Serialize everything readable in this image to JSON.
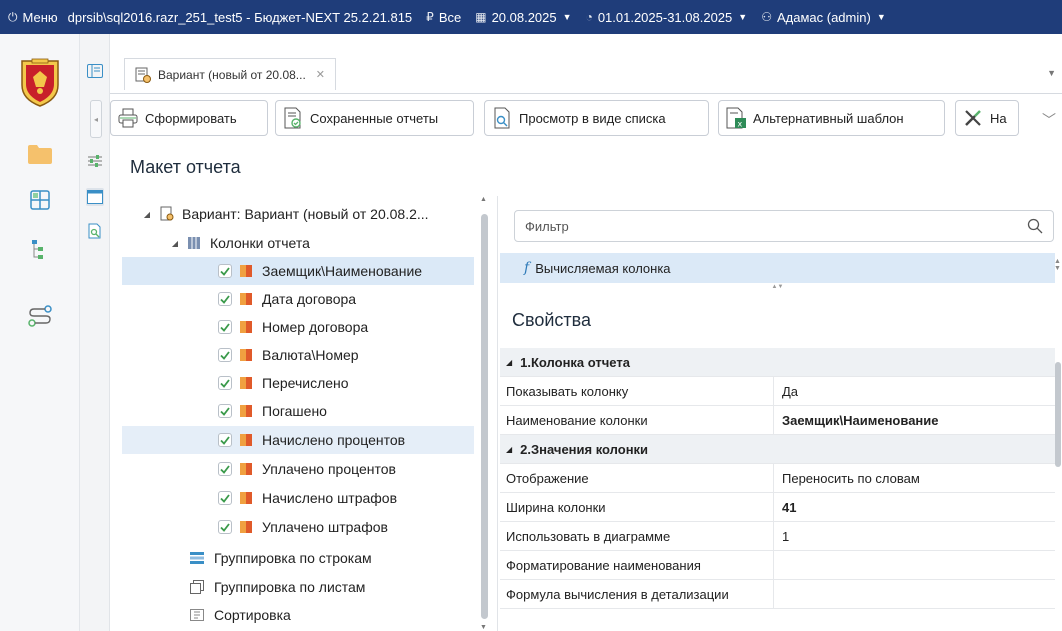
{
  "topbar": {
    "menu": "Меню",
    "connection": "dprsib\\sql2016.razr_251_test5 - Бюджет-NEXT 25.2.21.815",
    "scope": "Все",
    "date": "20.08.2025",
    "period": "01.01.2025-31.08.2025",
    "user": "Адамас (admin)"
  },
  "tab": {
    "title": "Вариант (новый от 20.08...",
    "close": "✕"
  },
  "toolbar": {
    "generate": "Сформировать",
    "saved_reports": "Сохраненные отчеты",
    "list_view": "Просмотр в виде списка",
    "alt_template": "Альтернативный шаблон",
    "more": "На"
  },
  "layout_title": "Макет отчета",
  "tree": {
    "root": "Вариант: Вариант (новый от 20.08.2...",
    "columns_node": "Колонки отчета",
    "columns": [
      "Заемщик\\Наименование",
      "Дата договора",
      "Номер договора",
      "Валюта\\Номер",
      "Перечислено",
      "Погашено",
      "Начислено процентов",
      "Уплачено процентов",
      "Начислено штрафов",
      "Уплачено штрафов"
    ],
    "row_grouping": "Группировка по строкам",
    "sheet_grouping": "Группировка по листам",
    "sorting": "Сортировка"
  },
  "filter_placeholder": "Фильтр",
  "calc_column": "Вычисляемая колонка",
  "properties": {
    "title": "Свойства",
    "cat1": "1.Колонка отчета",
    "show_col_k": "Показывать колонку",
    "show_col_v": "Да",
    "col_name_k": "Наименование колонки",
    "col_name_v": "Заемщик\\Наименование",
    "cat2": "2.Значения колонки",
    "display_k": "Отображение",
    "display_v": "Переносить по словам",
    "width_k": "Ширина колонки",
    "width_v": "41",
    "diagram_k": "Использовать в диаграмме",
    "diagram_v": "1",
    "fmt_k": "Форматирование наименования",
    "fmt_v": "",
    "formula_k": "Формула вычисления в детализации",
    "formula_v": ""
  },
  "colors": {
    "topbar": "#1f3d7a",
    "selection": "#dbe9f7",
    "folder": "#f5c16c",
    "accent": "#2e7ab8"
  }
}
